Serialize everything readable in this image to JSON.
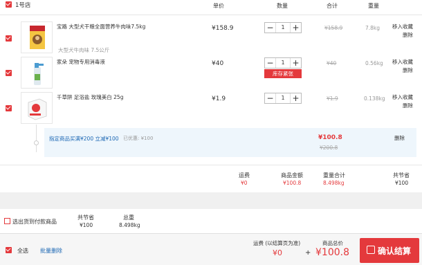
{
  "store": {
    "name": "1号店"
  },
  "columns": {
    "price": "单价",
    "qty": "数量",
    "subtotal": "合计",
    "weight": "重量"
  },
  "items": [
    {
      "name": "宝路 大型犬干粮全面营养牛肉味7.5kg",
      "spec": "大型犬牛肉味 7.5公斤",
      "price": "¥158.9",
      "qty": "1",
      "subtotal": "¥158.9",
      "weight": "7.8kg",
      "fav": "移入收藏",
      "del": "删除"
    },
    {
      "name": "家朵 宠物专用消毒液",
      "price": "¥40",
      "qty": "1",
      "stock_note": "库存紧张",
      "subtotal": "¥40",
      "weight": "0.56kg",
      "fav": "移入收藏",
      "del": "删除"
    },
    {
      "name": "千草阱 足浴盐 玫瑰美白 25g",
      "price": "¥1.9",
      "qty": "1",
      "subtotal": "¥1.9",
      "weight": "0.138kg",
      "fav": "移入收藏",
      "del": "删除"
    }
  ],
  "promo": {
    "text": "指定商品买满¥200 立减¥100",
    "discount": "已优惠: ¥100",
    "total": "¥100.8",
    "original": "¥200.8",
    "del": "删除"
  },
  "store_summary": {
    "shipping_label": "运费",
    "shipping_value": "¥0",
    "goods_label": "商品金额",
    "goods_value": "¥100.8",
    "weight_label": "重量合计",
    "weight_value": "8.498kg",
    "saved_label": "共节省",
    "saved_value": "¥100"
  },
  "filter": {
    "label": "选出货到付款商品",
    "saved_label": "共节省",
    "saved_value": "¥100",
    "weight_label": "总重",
    "weight_value": "8.498kg"
  },
  "bottom": {
    "select_all": "全选",
    "batch_delete": "批量删除",
    "shipping_label": "运费 (以结算页为准)",
    "shipping_value": "¥0",
    "plus": "+",
    "total_label": "商品总价",
    "total_value": "¥100.8",
    "checkout": "确认结算"
  }
}
